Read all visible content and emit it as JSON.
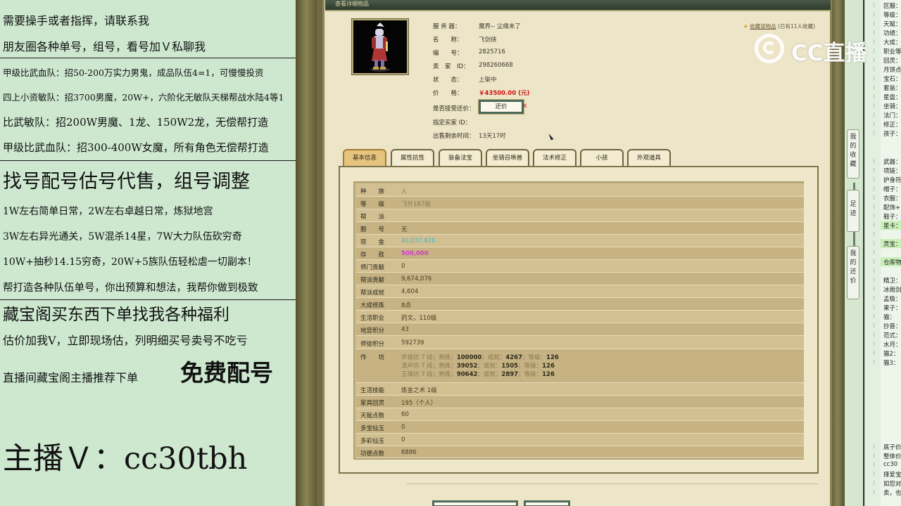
{
  "promo": {
    "lines": [
      "需要操手或者指挥，请联系我",
      "朋友圈各种单号，组号，看号加Ｖ私聊我",
      "甲级比武血队：招50-200万实力男鬼，成品队伍4=1，可慢慢投资",
      "四上小资敏队：招3700男魔，20W+，六阶化无敏队天梯帮战水陆4等1",
      "比武敏队：招200W男魔、1龙、150W2龙，无偿帮打造",
      "甲级比武血队：招300-400W女魔，所有角色无偿帮打造",
      "找号配号估号代售，组号调整",
      "1W左右简单日常，2W左右卓越日常，炼狱地宫",
      "3W左右异光通关，5W混杀14星，7W大力队伍砍穷奇",
      "10W+抽秒14.15穷奇，20W+5族队伍轻松虐一切副本！",
      "帮打造各种队伍单号，你出预算和想法，我帮你做到极致",
      "藏宝阁买东西下单找我各种福利",
      "估价加我V，立即现场估，列明细买号卖号不吃亏",
      "直播间藏宝阁主播推荐下单",
      "免费配号",
      "主播Ｖ：cc30tbh"
    ]
  },
  "window": {
    "title": "查看详细物品",
    "info": {
      "server_label": "服 务 器：",
      "server_value": "魔界-- 尘缘未了",
      "name_label": "名　　称：",
      "name_value": "飞剑侠",
      "id_label": "编　　号：",
      "id_value": "2825716",
      "seller_label": "卖　家　ID：",
      "seller_value": "298260668",
      "status_label": "状　　态：",
      "status_value": "上架中",
      "price_label": "价　　格：",
      "price_value": "￥43500.00 (元)",
      "haggle_label": "是否接受还价：",
      "haggle_button": "还价",
      "buyer_label": "指定买家 ID：",
      "time_label": "出售剩余时间：",
      "time_value": "13天17时"
    },
    "favorite": {
      "icon": "star-icon",
      "link": "收藏该物品",
      "count_text": "(已有11人收藏)"
    },
    "tabs": [
      "基本信息",
      "属性抗性",
      "装备法宝",
      "坐骑召唤兽",
      "法术修正",
      "小孩",
      "外观道具"
    ],
    "rows": [
      {
        "key": "种　　族",
        "value": "人"
      },
      {
        "key": "等　　级",
        "value": "飞升187级"
      },
      {
        "key": "帮　　派",
        "value": ""
      },
      {
        "key": "靓　　号",
        "value": "无"
      },
      {
        "key": "现　　金",
        "value": "40,037,626"
      },
      {
        "key": "存　　款",
        "value": "500,000"
      },
      {
        "key": "师门贡献",
        "value": "0"
      },
      {
        "key": "帮派贡献",
        "value": "9,674,076"
      },
      {
        "key": "帮派成就",
        "value": "4,604"
      },
      {
        "key": "大成修炼",
        "value": "8点"
      },
      {
        "key": "生活职业",
        "value": "药文，110级"
      },
      {
        "key": "地宫积分",
        "value": "43"
      },
      {
        "key": "师徒积分",
        "value": "592739"
      },
      {
        "key": "作　　坊",
        "lines": [
          {
            "a": "步摇坊 7 段；",
            "b": "熟练：",
            "c": "100000",
            "d": "；成就：",
            "e": "4267",
            "f": "；等级：",
            "g": "126"
          },
          {
            "a": "清声坊 7 段；",
            "b": "熟练：",
            "c": "39052",
            "d": "；成就：",
            "e": "1505",
            "f": "；等级：",
            "g": "126"
          },
          {
            "a": "玉璃坊 7 段；",
            "b": "熟练：",
            "c": "90642",
            "d": "；成就：",
            "e": "2897",
            "f": "；等级：",
            "g": "126"
          }
        ]
      },
      {
        "key": "生活技能",
        "value": "炼金之术 1级"
      },
      {
        "key": "家具回灵",
        "value": "195（个人）"
      },
      {
        "key": "天赋点数",
        "value": "60"
      },
      {
        "key": "多宝仙玉",
        "value": "0"
      },
      {
        "key": "多彩仙玉",
        "value": "0"
      },
      {
        "key": "功德点数",
        "value": "6886"
      }
    ]
  },
  "side_buttons": [
    "我的收藏",
    "足迹",
    "我的还价"
  ],
  "right_col": {
    "lines_top": [
      "区服：",
      "等级：",
      "天赋：",
      "功绩：",
      "大成：",
      "职业等",
      "回灵：",
      "月饼点",
      "宝石：",
      "套装：",
      "星盘：",
      "坐骑：",
      "法门：",
      "修正：",
      "孩子："
    ],
    "lines_mid": [
      "武器：",
      "项链：",
      "护身符",
      "帽子：",
      "衣服：",
      "配饰+",
      "鞋子：",
      "星卡：",
      "",
      "灵宝：",
      "",
      "仓库物",
      "",
      "精卫：",
      "冰雨剑",
      "孟极：",
      "果子：",
      "猫：",
      "抄普：",
      "范式：",
      "水月：",
      "猫2：",
      "猫3："
    ],
    "lines_bottom": [
      "底子价",
      "整体价",
      "cc30",
      "择爱宝",
      "如您对",
      "卖，也"
    ]
  },
  "cc_logo": "CC直播"
}
